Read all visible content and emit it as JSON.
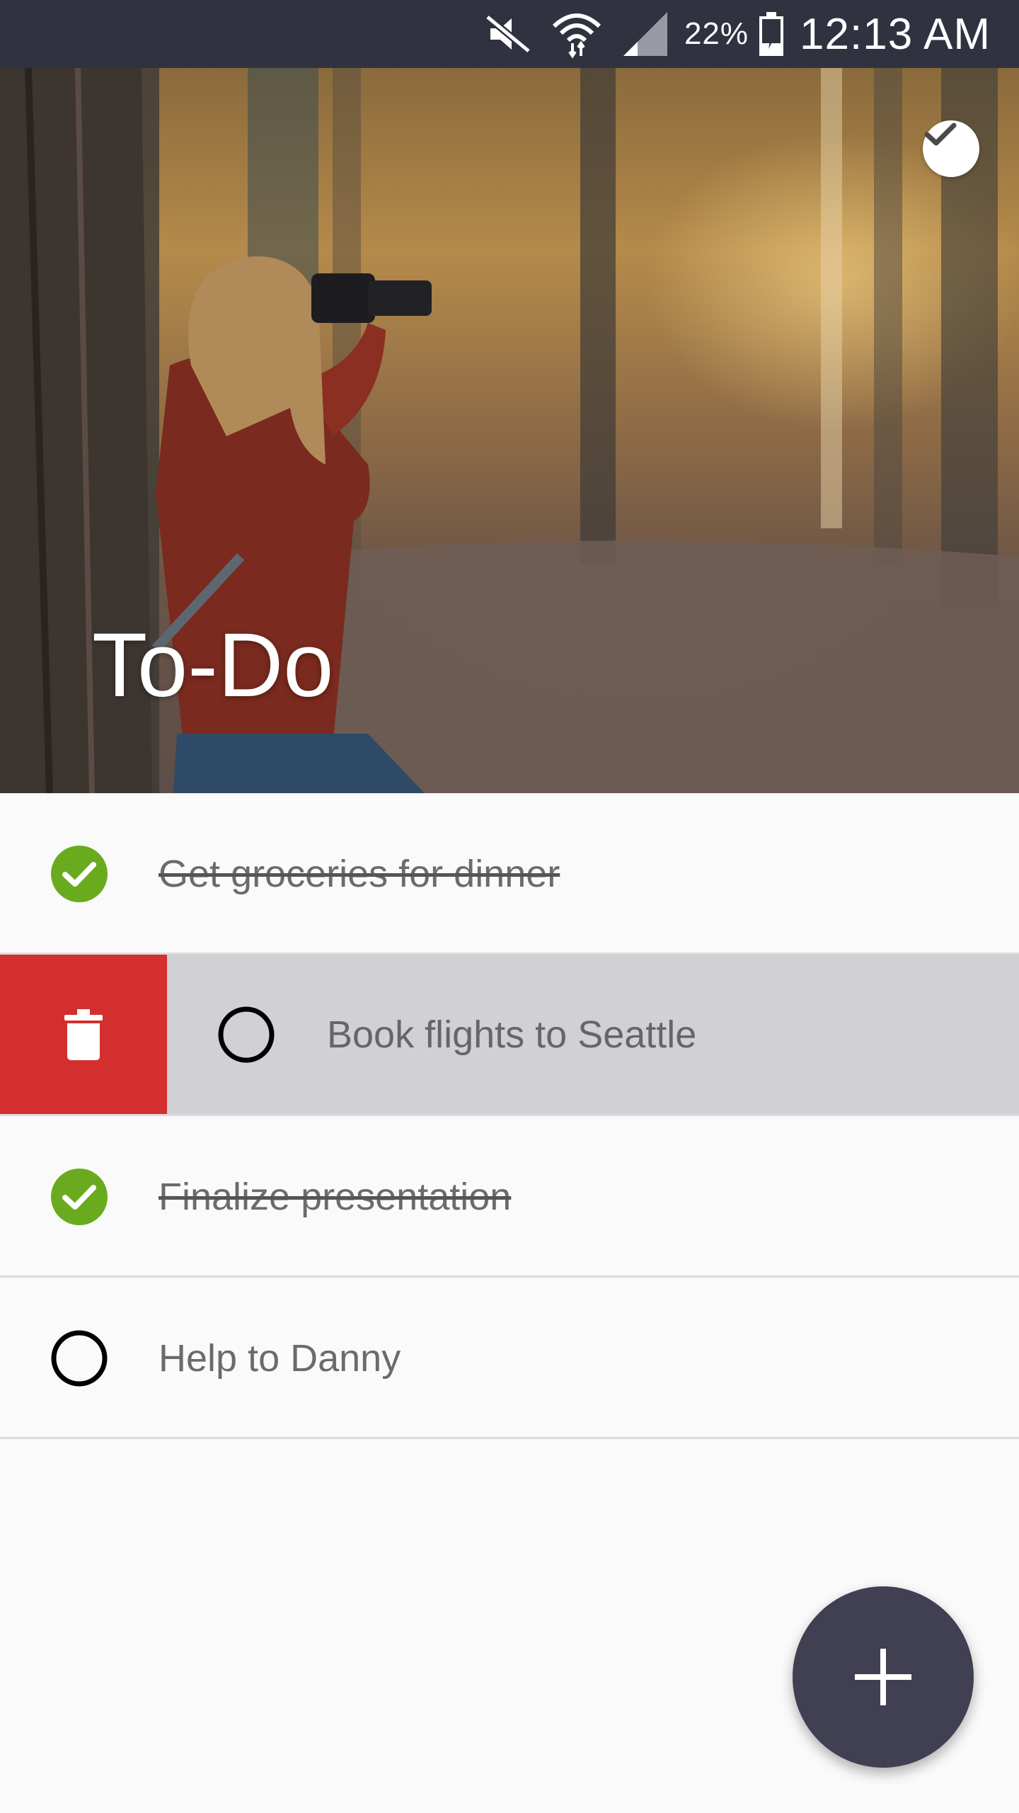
{
  "status_bar": {
    "icons": [
      "mute-icon",
      "wifi-icon",
      "signal-icon",
      "battery-charging-icon"
    ],
    "battery_percent": "22%",
    "time": "12:13 AM"
  },
  "header": {
    "title": "To-Do",
    "background_image": "photographer-in-autumn-forest",
    "action_icon": "check-icon"
  },
  "tasks": [
    {
      "label": "Get groceries for dinner",
      "completed": true
    },
    {
      "label": "Book flights to Seattle",
      "completed": false,
      "swipe_action": "delete-icon"
    },
    {
      "label": "Finalize presentation",
      "completed": true
    },
    {
      "label": "Help to Danny",
      "completed": false
    }
  ],
  "fab": {
    "icon": "plus-icon"
  },
  "colors": {
    "status_bar": "#303240",
    "complete_green": "#6aaa1e",
    "delete_red": "#d32f2f",
    "fab": "#404052",
    "swiped_row": "#d1d0d4"
  }
}
